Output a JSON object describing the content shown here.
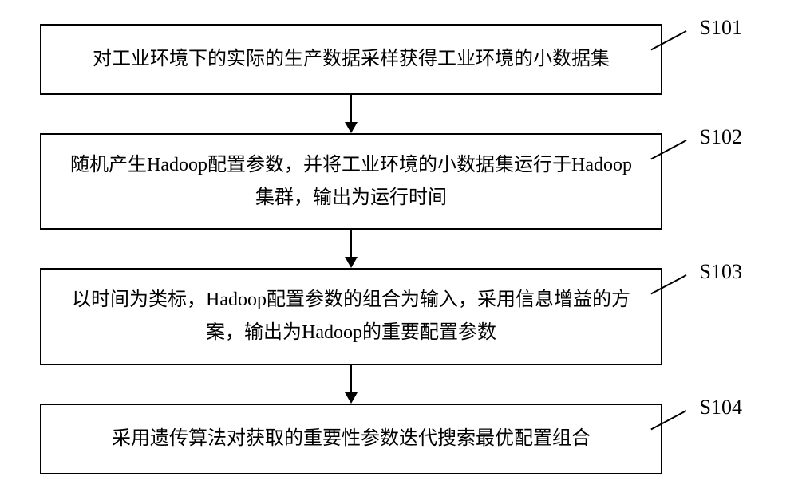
{
  "chart_data": {
    "type": "flowchart",
    "title": "",
    "steps": [
      {
        "id": "S101",
        "text": "对工业环境下的实际的生产数据采样获得工业环境的小数据集"
      },
      {
        "id": "S102",
        "text": "随机产生Hadoop配置参数，并将工业环境的小数据集运行于Hadoop集群，输出为运行时间"
      },
      {
        "id": "S103",
        "text": "以时间为类标，Hadoop配置参数的组合为输入，采用信息增益的方案，输出为Hadoop的重要配置参数"
      },
      {
        "id": "S104",
        "text": "采用遗传算法对获取的重要性参数迭代搜索最优配置组合"
      }
    ]
  }
}
